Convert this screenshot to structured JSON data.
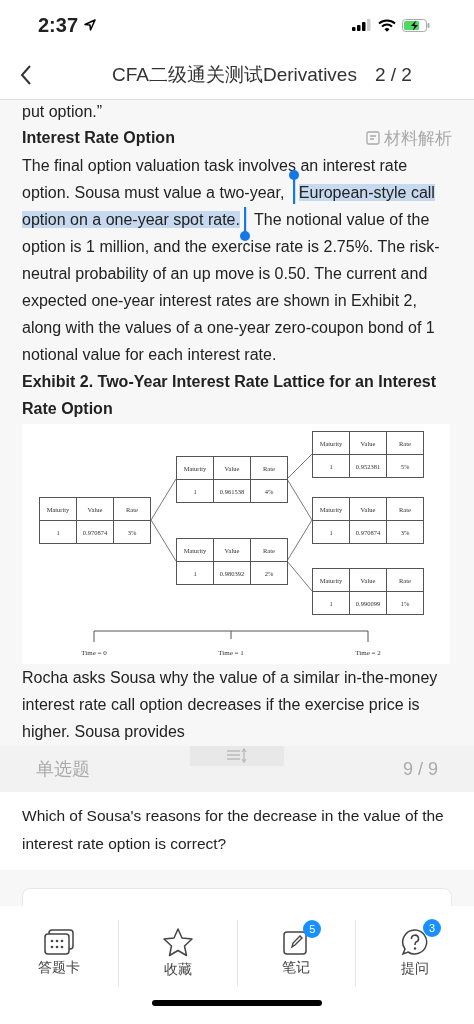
{
  "status_bar": {
    "time": "2:37"
  },
  "nav": {
    "title": "CFA二级通关测试Derivatives",
    "counter": "2 / 2"
  },
  "passage": {
    "lead": "put option.”",
    "section_title": "Interest Rate Option",
    "material_link": "材料解析",
    "paragraph": [
      {
        "text": "The final option valuation task involves an interest rate option. Sousa must value a two-year, ",
        "highlighted": false
      },
      {
        "text": "European-style call option on a one-year spot rate.",
        "highlighted": true
      },
      {
        "text": " The notional value of the option is 1 million, and the exercise rate is 2.75%. The risk-neutral probability of an up move is 0.50. The current and expected one-year interest rates are shown in Exhibit 2, along with the values of a one-year zero-coupon bond of 1 notional value for each interest rate.",
        "highlighted": false
      }
    ],
    "exhibit_title": "Exhibit 2. Two-Year Interest Rate Lattice for an Interest Rate Option",
    "lattice": {
      "nodes": [
        {
          "headers": [
            "Maturity",
            "Value",
            "Rate"
          ],
          "values": [
            "1",
            "0.970874",
            "3%"
          ]
        },
        {
          "headers": [
            "Maturity",
            "Value",
            "Rate"
          ],
          "values": [
            "1",
            "0.961538",
            "4%"
          ]
        },
        {
          "headers": [
            "Maturity",
            "Value",
            "Rate"
          ],
          "values": [
            "1",
            "0.980392",
            "2%"
          ]
        },
        {
          "headers": [
            "Maturity",
            "Value",
            "Rate"
          ],
          "values": [
            "1",
            "0.952381",
            "5%"
          ]
        },
        {
          "headers": [
            "Maturity",
            "Value",
            "Rate"
          ],
          "values": [
            "1",
            "0.970874",
            "3%"
          ]
        },
        {
          "headers": [
            "Maturity",
            "Value",
            "Rate"
          ],
          "values": [
            "1",
            "0.990099",
            "1%"
          ]
        }
      ],
      "times": [
        "Time = 0",
        "Time = 1",
        "Time = 2"
      ]
    },
    "follow_up": "Rocha asks Sousa why the value of a similar in-the-money interest rate call option decreases if the exercise price is higher. Sousa provides"
  },
  "question": {
    "type": "单选题",
    "counter": "9 / 9",
    "text": "Which of Sousa's reasons for the decrease in the value of the interest rate option is correct?"
  },
  "tab_bar": [
    {
      "kind": "card",
      "label": "答题卡"
    },
    {
      "kind": "star",
      "label": "收藏"
    },
    {
      "kind": "note",
      "label": "笔记",
      "badge": "5"
    },
    {
      "kind": "ask",
      "label": "提问",
      "badge": "3"
    }
  ]
}
